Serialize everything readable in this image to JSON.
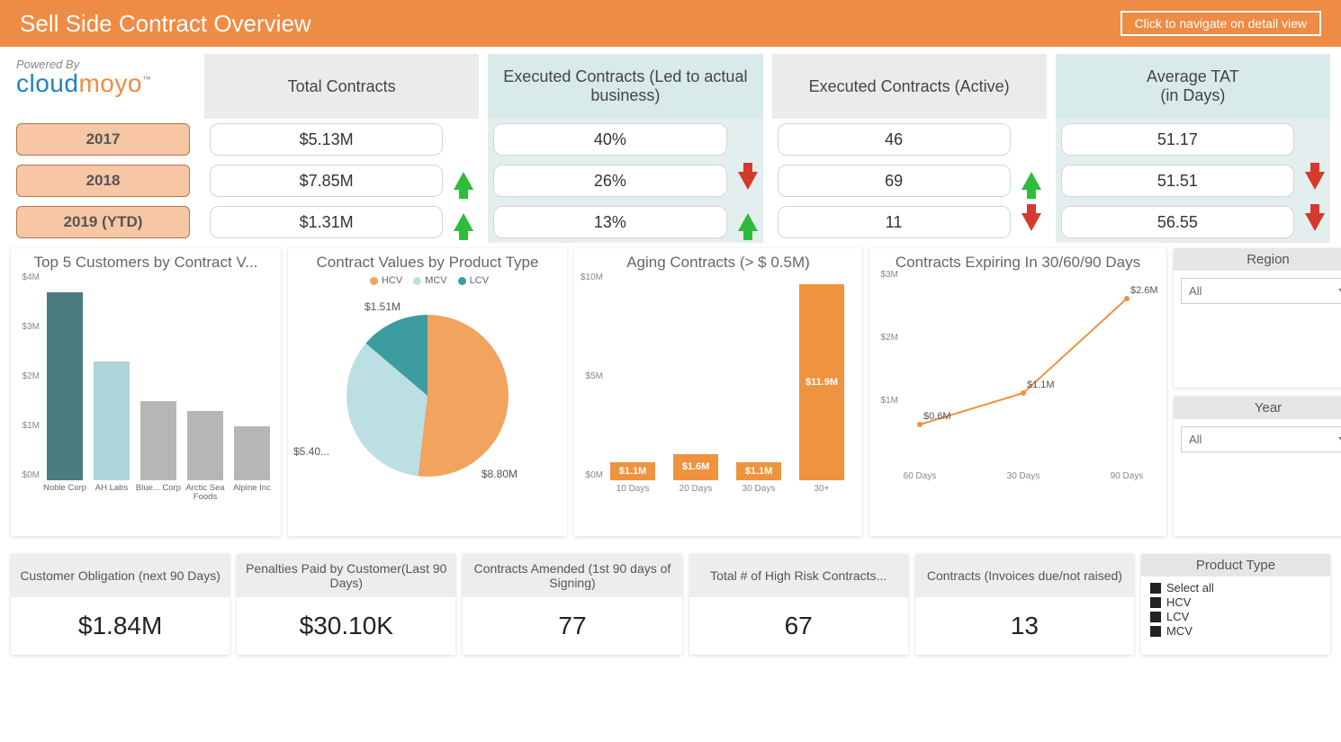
{
  "header": {
    "title": "Sell Side Contract Overview",
    "nav_button": "Click to navigate on detail view"
  },
  "brand": {
    "powered": "Powered By",
    "logo_left": "cloud",
    "logo_right": "moyo",
    "tm": "™"
  },
  "metric_headers": [
    "Total Contracts",
    "Executed Contracts (Led to actual business)",
    "Executed Contracts  (Active)",
    "Average TAT\n(in Days)"
  ],
  "years": [
    {
      "label": "2017",
      "vals": [
        "$5.13M",
        "40%",
        "46",
        "51.17"
      ],
      "trends": [
        null,
        null,
        null,
        null
      ]
    },
    {
      "label": "2018",
      "vals": [
        "$7.85M",
        "26%",
        "69",
        "51.51"
      ],
      "trends": [
        "up",
        "down",
        "up",
        "down"
      ]
    },
    {
      "label": "2019 (YTD)",
      "vals": [
        "$1.31M",
        "13%",
        "11",
        "56.55"
      ],
      "trends": [
        "up",
        "up",
        "down",
        "down"
      ]
    }
  ],
  "chart_data": [
    {
      "type": "bar",
      "title": "Top 5 Customers by Contract V...",
      "categories": [
        "Noble Corp",
        "AH Labs",
        "Blue... Corp",
        "Arctic Sea Foods",
        "Alpine Inc"
      ],
      "values": [
        3.8,
        2.4,
        1.6,
        1.4,
        1.1
      ],
      "ylabel": "$M",
      "ylim": [
        0,
        4
      ],
      "yticks": [
        "$0M",
        "$1M",
        "$2M",
        "$3M",
        "$4M"
      ],
      "colors": [
        "#4b7c80",
        "#add4d8",
        "#b6b6b6",
        "#b6b6b6",
        "#b6b6b6"
      ]
    },
    {
      "type": "pie",
      "title": "Contract Values by Product Type",
      "series": [
        {
          "name": "HCV",
          "value": 8.8,
          "label": "$8.80M",
          "color": "#f2a35e"
        },
        {
          "name": "MCV",
          "value": 5.4,
          "label": "$5.40...",
          "color": "#bcdfe4"
        },
        {
          "name": "LCV",
          "value": 1.51,
          "label": "$1.51M",
          "color": "#3d9ca0"
        }
      ]
    },
    {
      "type": "bar",
      "title": "Aging Contracts (> $ 0.5M)",
      "categories": [
        "10 Days",
        "20 Days",
        "30 Days",
        "30+"
      ],
      "values": [
        1.1,
        1.6,
        1.1,
        11.9
      ],
      "labels": [
        "$1.1M",
        "$1.6M",
        "$1.1M",
        "$11.9M"
      ],
      "ylim": [
        0,
        12
      ],
      "yticks": [
        "$0M",
        "$5M",
        "$10M"
      ],
      "color": "#ef933f"
    },
    {
      "type": "line",
      "title": "Contracts Expiring In 30/60/90 Days",
      "x": [
        "60 Days",
        "30 Days",
        "90 Days"
      ],
      "values": [
        0.6,
        1.1,
        2.6
      ],
      "labels": [
        "$0.6M",
        "$1.1M",
        "$2.6M"
      ],
      "ylim": [
        0,
        3
      ],
      "yticks": [
        "$1M",
        "$2M",
        "$3M"
      ],
      "color": "#ef933f"
    }
  ],
  "slicers": {
    "region": {
      "title": "Region",
      "value": "All"
    },
    "year": {
      "title": "Year",
      "value": "All"
    },
    "product_type": {
      "title": "Product Type",
      "options": [
        "Select all",
        "HCV",
        "LCV",
        "MCV"
      ]
    }
  },
  "kpis": [
    {
      "title": "Customer Obligation (next 90 Days)",
      "value": "$1.84M"
    },
    {
      "title": "Penalties Paid by Customer(Last 90 Days)",
      "value": "$30.10K"
    },
    {
      "title": "Contracts Amended (1st 90 days of Signing)",
      "value": "77"
    },
    {
      "title": "Total # of High Risk Contracts...",
      "value": "67"
    },
    {
      "title": "Contracts (Invoices due/not raised)",
      "value": "13"
    }
  ]
}
